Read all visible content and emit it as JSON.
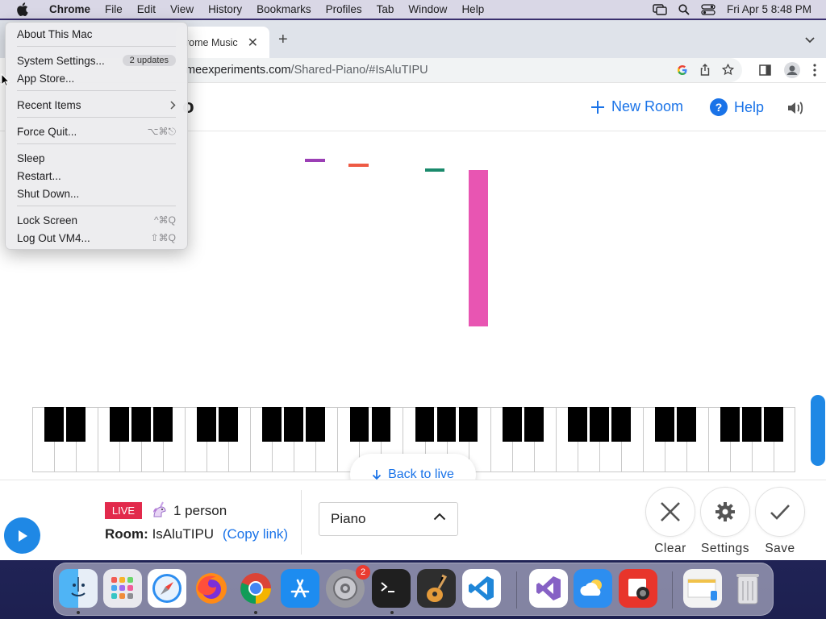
{
  "menubar": {
    "app_name": "Chrome",
    "items": [
      "File",
      "Edit",
      "View",
      "History",
      "Bookmarks",
      "Profiles",
      "Tab",
      "Window",
      "Help"
    ],
    "clock": "Fri Apr 5  8:48 PM"
  },
  "apple_menu": {
    "about": "About This Mac",
    "system_settings": "System Settings...",
    "updates_badge": "2 updates",
    "app_store": "App Store...",
    "recent_items": "Recent Items",
    "force_quit": "Force Quit...",
    "force_quit_shortcut": "⌥⌘⎋",
    "sleep": "Sleep",
    "restart": "Restart...",
    "shut_down": "Shut Down...",
    "lock_screen": "Lock Screen",
    "lock_shortcut": "^⌘Q",
    "log_out": "Log Out VM4...",
    "log_out_shortcut": "⇧⌘Q"
  },
  "browser": {
    "tab_title": "rome Music",
    "url_host": "meexperiments.com",
    "url_path": "/Shared-Piano/#IsAluTIPU"
  },
  "site": {
    "title_fragment": "o",
    "new_room": "New Room",
    "help": "Help",
    "back_to_live": "Back to live"
  },
  "notes_colors": [
    "#9b3fb5",
    "#ee5a44",
    "#1a8a6c",
    "#e855b2"
  ],
  "bottom": {
    "live": "LIVE",
    "person_count": "1 person",
    "room_label": "Room:",
    "room_code": "IsAluTIPU",
    "copy_link": "(Copy link)",
    "instrument": "Piano",
    "actions": {
      "clear": "Clear",
      "settings": "Settings",
      "save": "Save"
    }
  },
  "accent": "#1a73e8",
  "dock": {
    "settings_badge": "2"
  }
}
